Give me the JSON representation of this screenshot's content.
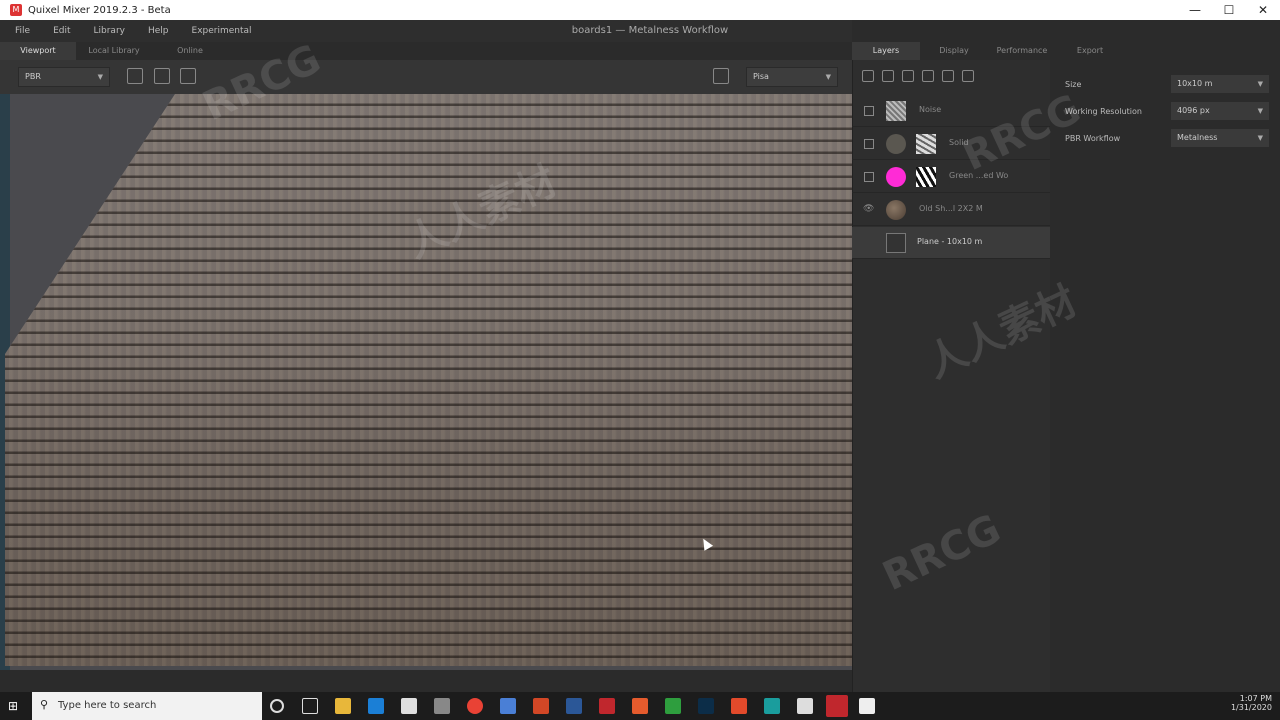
{
  "window": {
    "title": "Quixel Mixer 2019.2.3 - Beta",
    "controls": [
      "—",
      "☐",
      "✕"
    ]
  },
  "menu": [
    "File",
    "Edit",
    "Library",
    "Help",
    "Experimental"
  ],
  "document_title": "boards1 — Metalness Workflow",
  "viewport_tabs": [
    {
      "label": "Viewport",
      "active": true
    },
    {
      "label": "Local Library",
      "active": false
    },
    {
      "label": "Online",
      "active": false
    }
  ],
  "viewport_toolbar": {
    "render_mode": "PBR",
    "environment": "Pisa"
  },
  "right_tabs": [
    {
      "label": "Layers",
      "active": true
    },
    {
      "label": "Display",
      "active": false
    },
    {
      "label": "Performance",
      "active": false
    },
    {
      "label": "Export",
      "active": false
    }
  ],
  "layers": [
    {
      "name": "Noise",
      "control": "checkbox",
      "thumb_color": "#888888",
      "thumb2": false
    },
    {
      "name": "Solid",
      "control": "checkbox",
      "thumb_color": "#5a5750",
      "thumb2": true
    },
    {
      "name": "Green ...ed Wo",
      "control": "checkbox",
      "thumb_color": "#ff2bd6",
      "thumb2": true
    },
    {
      "name": "Old Sh...l 2X2 M",
      "control": "eye",
      "thumb_color": "#6b5a48",
      "thumb2": false
    },
    {
      "name": "Plane - 10x10 m",
      "control": "none",
      "thumb_color": "#3b3b3b",
      "thumb2": false,
      "selected": true
    }
  ],
  "properties": [
    {
      "label": "Size",
      "value": "10x10 m"
    },
    {
      "label": "Working Resolution",
      "value": "4096 px"
    },
    {
      "label": "PBR Workflow",
      "value": "Metalness"
    }
  ],
  "taskbar": {
    "search_placeholder": "Type here to search",
    "time": "1:07 PM",
    "date": "1/31/2020"
  },
  "watermarks": [
    "RRCG",
    "人人素材",
    "RRCG",
    "人人素材",
    "RRCG"
  ]
}
